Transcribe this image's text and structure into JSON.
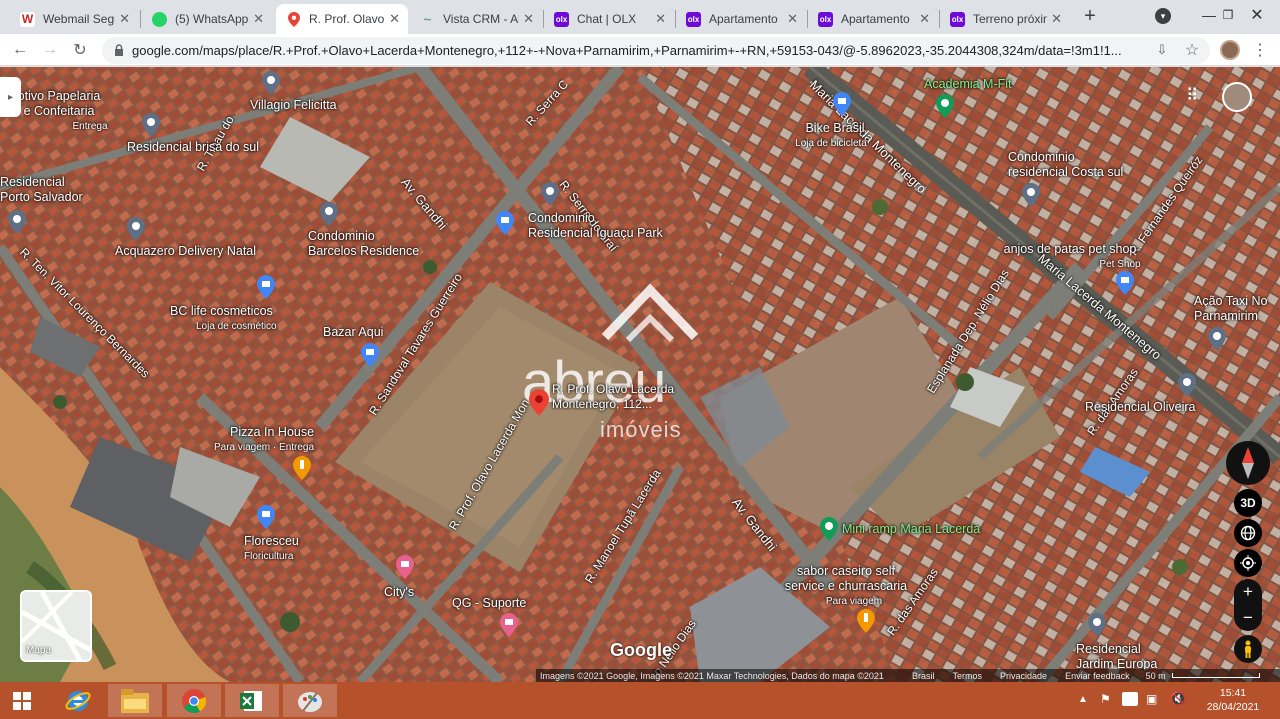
{
  "tabs": [
    {
      "title": "Webmail Seguro",
      "favicon_text": "W",
      "favicon_color": "#c62828",
      "active": false
    },
    {
      "title": "(5) WhatsApp",
      "favicon_text": "✆",
      "favicon_color": "#25d366",
      "active": false
    },
    {
      "title": "R. Prof. Olavo Lacerda",
      "favicon_text": "📍",
      "favicon_color": "#ffffff",
      "active": true
    },
    {
      "title": "Vista CRM - Al",
      "favicon_text": "~",
      "favicon_color": "#5fa8a0",
      "active": false
    },
    {
      "title": "Chat | OLX",
      "favicon_text": "olx",
      "favicon_color": "#6e0ad6",
      "active": false
    },
    {
      "title": "Apartamento",
      "favicon_text": "olx",
      "favicon_color": "#6e0ad6",
      "active": false
    },
    {
      "title": "Apartamento",
      "favicon_text": "olx",
      "favicon_color": "#6e0ad6",
      "active": false
    },
    {
      "title": "Terreno próximo",
      "favicon_text": "olx",
      "favicon_color": "#6e0ad6",
      "active": false
    }
  ],
  "new_tab": "+",
  "url": "google.com/maps/place/R.+Prof.+Olavo+Lacerda+Montenegro,+112+-+Nova+Parnamirim,+Parnamirim+-+RN,+59153-043/@-5.8962023,-35.2044308,324m/data=!3m1!1...",
  "map": {
    "places": [
      {
        "id": "papelaria",
        "name": "otivo Papelaria\ne Confeitaria",
        "sub": "Entrega"
      },
      {
        "id": "villagio",
        "name": "Villagio Felicitta",
        "sub": ""
      },
      {
        "id": "brisa",
        "name": "Residencial brisa do sul",
        "sub": ""
      },
      {
        "id": "porto",
        "name": "Residencial\nPorto Salvador",
        "sub": ""
      },
      {
        "id": "acquazero",
        "name": "Acquazero Delivery Natal",
        "sub": ""
      },
      {
        "id": "barcelos",
        "name": "Condominio\nBarcelos Residence",
        "sub": ""
      },
      {
        "id": "iguacu",
        "name": "Condominio\nResidencial Iguaçu Park",
        "sub": ""
      },
      {
        "id": "bikebrasil",
        "name": "Bike Brasil",
        "sub": "Loja de bicicleta"
      },
      {
        "id": "academia",
        "name": "Academia M-Fit",
        "sub": ""
      },
      {
        "id": "costasul",
        "name": "Condominio\nresidencial Costa sul",
        "sub": ""
      },
      {
        "id": "anjos",
        "name": "anjos de patas pet shop",
        "sub": "Pet Shop"
      },
      {
        "id": "taxi",
        "name": "Ação Taxi No\nParnamirim",
        "sub": ""
      },
      {
        "id": "bclife",
        "name": "BC life cosmeticos",
        "sub": "Loja de cosmético"
      },
      {
        "id": "bazar",
        "name": "Bazar Aqui",
        "sub": ""
      },
      {
        "id": "pizza",
        "name": "Pizza In House",
        "sub": "Para viagem · Entrega"
      },
      {
        "id": "floresceu",
        "name": "Floresceu",
        "sub": "Floricultura"
      },
      {
        "id": "citys",
        "name": "City's",
        "sub": ""
      },
      {
        "id": "qg",
        "name": "QG - Suporte",
        "sub": ""
      },
      {
        "id": "oliveira",
        "name": "Residencial Oliveira",
        "sub": ""
      },
      {
        "id": "miniramp",
        "name": "Mini ramp Maria Lacerda",
        "sub": ""
      },
      {
        "id": "sabor",
        "name": "sabor caseiro self\nservice e churrascaria",
        "sub": "Para viagem"
      },
      {
        "id": "europa",
        "name": "Residencial\nJardim Europa",
        "sub": ""
      },
      {
        "id": "selected",
        "name": "R. Prof. Olavo Lacerda\nMontenegro, 112...",
        "sub": ""
      }
    ],
    "roads": [
      "R. Serra C",
      "R. Tibau do",
      "Av. Gandhi",
      "R. Serra do Araí",
      "Maria Lacerda Montenegro",
      "R. Fernandes Queiróz",
      "R. Ten. Vitor Lourenço Bernardes",
      "R. Sandoval Tavares Guerreiro",
      "R. Prof. Olavo Lacerda Mon",
      "R. Manoel Tupã Lacerda",
      "Av. Gandhi",
      "Esplanada Dep. Nélio Dias",
      "Maria Lacerda Montenegro",
      "R. das Amoras",
      "R. das Amoras",
      "o Nélio Dias"
    ],
    "watermark_brand": "abreu",
    "watermark_sub": "imóveis",
    "layer_toggle": "Mapa",
    "google_logo": "Google",
    "attribution": "Imagens ©2021 Google, Imagens ©2021 Maxar Technologies, Dados do mapa ©2021",
    "footer_links": [
      "Brasil",
      "Termos",
      "Privacidade",
      "Enviar feedback"
    ],
    "scale": "50 m",
    "btn_3d": "3D",
    "zoom_in": "+",
    "zoom_out": "−"
  },
  "taskbar": {
    "time": "15:41",
    "date": "28/04/2021"
  }
}
